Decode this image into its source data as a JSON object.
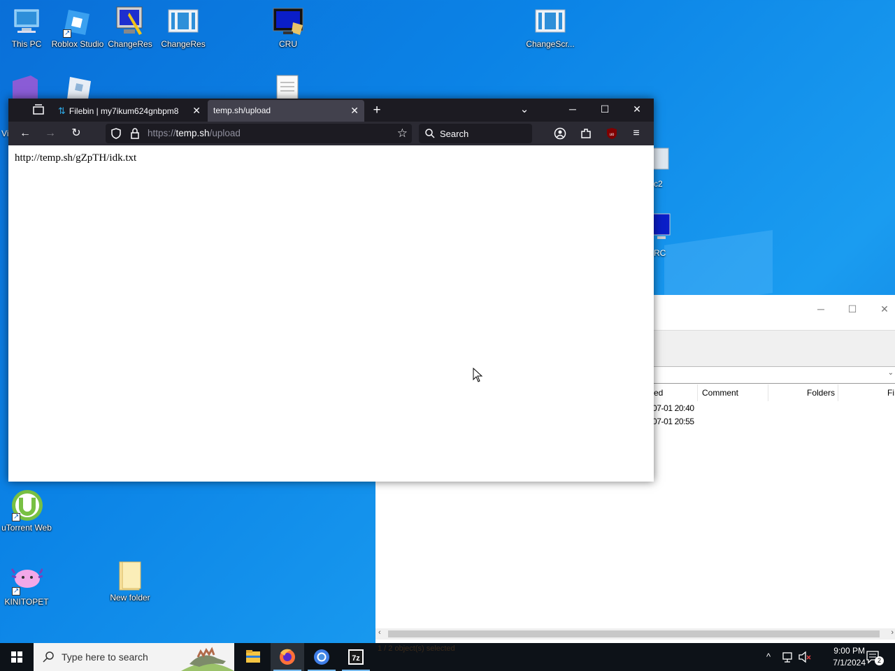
{
  "desktop": {
    "icons": [
      {
        "label": "This PC",
        "icon": "this-pc-icon"
      },
      {
        "label": "Roblox Studio",
        "icon": "roblox-studio-icon"
      },
      {
        "label": "ChangeRes",
        "icon": "changeres-app-icon"
      },
      {
        "label": "ChangeRes",
        "icon": "changeres-window-icon"
      },
      {
        "label": "CRU",
        "icon": "cru-monitor-icon"
      },
      {
        "label": "ChangeScr...",
        "icon": "changescr-window-icon"
      },
      {
        "label": "uTorrent Web",
        "icon": "utorrent-icon"
      },
      {
        "label": "KINITOPET",
        "icon": "kinitopet-axolotl-icon"
      },
      {
        "label": "New folder",
        "icon": "folder-icon"
      }
    ],
    "partial_labels": {
      "c2": "c2",
      "rc": "RC",
      "vi": "Vi"
    }
  },
  "firefox": {
    "tabs": [
      {
        "label": "Filebin | my7ikum624gnbpm8",
        "icon": "filebin-icon"
      },
      {
        "label": "temp.sh/upload",
        "active": true
      }
    ],
    "url_prefix": "https://",
    "url_host": "temp.sh",
    "url_path": "/upload",
    "search_placeholder": "Search",
    "page_text": "http://temp.sh/gZpTH/idk.txt"
  },
  "sevenzip": {
    "columns": [
      "ed",
      "Comment",
      "Folders",
      "Fi"
    ],
    "rows": [
      "07-01 20:40",
      "07-01 20:55"
    ],
    "status": "1 / 2 object(s) selected"
  },
  "taskbar": {
    "search_placeholder": "Type here to search",
    "apps": [
      "file-explorer-icon",
      "firefox-icon",
      "chrome-icon",
      "7zip-icon"
    ],
    "time": "9:00 PM",
    "date": "7/1/2024",
    "notification_count": "2"
  }
}
